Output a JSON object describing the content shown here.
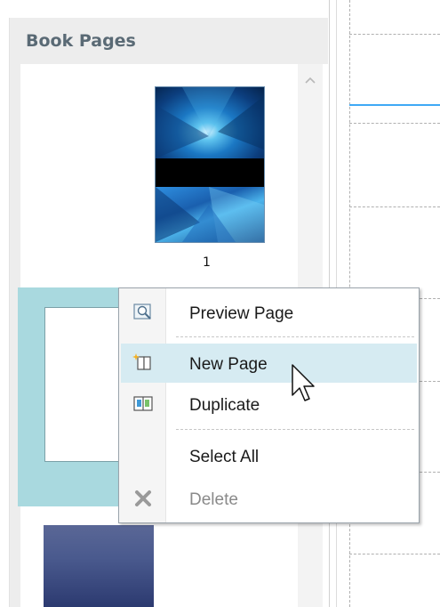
{
  "panel": {
    "title": "Book Pages"
  },
  "pages": [
    {
      "number": "1"
    }
  ],
  "context_menu": {
    "items": [
      {
        "label": "Preview Page",
        "icon": "preview-icon",
        "enabled": true
      },
      {
        "label": "New Page",
        "icon": "new-page-icon",
        "enabled": true,
        "hovered": true
      },
      {
        "label": "Duplicate",
        "icon": "duplicate-icon",
        "enabled": true
      },
      {
        "label": "Select All",
        "icon": "",
        "enabled": true
      },
      {
        "label": "Delete",
        "icon": "delete-icon",
        "enabled": false
      }
    ]
  },
  "colors": {
    "selection": "#a9d9df",
    "hover": "#d6ebf2",
    "guide": "#3fa9f5",
    "panel_title": "#5a6a75"
  }
}
